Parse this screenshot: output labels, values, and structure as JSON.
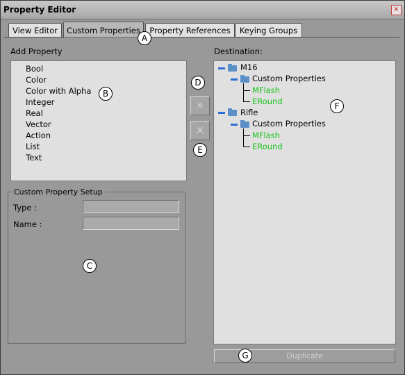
{
  "window": {
    "title": "Property Editor",
    "close_glyph": "×"
  },
  "tabs": [
    {
      "label": "View Editor",
      "active": false
    },
    {
      "label": "Custom Properties",
      "active": true
    },
    {
      "label": "Property References",
      "active": false
    },
    {
      "label": "Keying Groups",
      "active": false
    }
  ],
  "add_property": {
    "label": "Add Property",
    "items": [
      "Bool",
      "Color",
      "Color with Alpha",
      "Integer",
      "Real",
      "Vector",
      "Action",
      "List",
      "Text"
    ]
  },
  "setup": {
    "title": "Custom Property Setup",
    "type_label": "Type :",
    "name_label": "Name :",
    "type_value": "",
    "name_value": ""
  },
  "buttons": {
    "add_glyph": "»",
    "remove_glyph": "×",
    "duplicate_label": "Duplicate"
  },
  "destination": {
    "label": "Destination:",
    "tree": [
      {
        "name": "M16",
        "group": "Custom Properties",
        "props": [
          "MFlash",
          "ERound"
        ]
      },
      {
        "name": "Rifle",
        "group": "Custom Properties",
        "props": [
          "MFlash",
          "ERound"
        ]
      }
    ]
  },
  "callouts": {
    "a": "A",
    "b": "B",
    "c": "C",
    "d": "D",
    "e": "E",
    "f": "F",
    "g": "G"
  },
  "colors": {
    "property_green": "#19c419",
    "tree_minus_blue": "#2a6ed6"
  }
}
